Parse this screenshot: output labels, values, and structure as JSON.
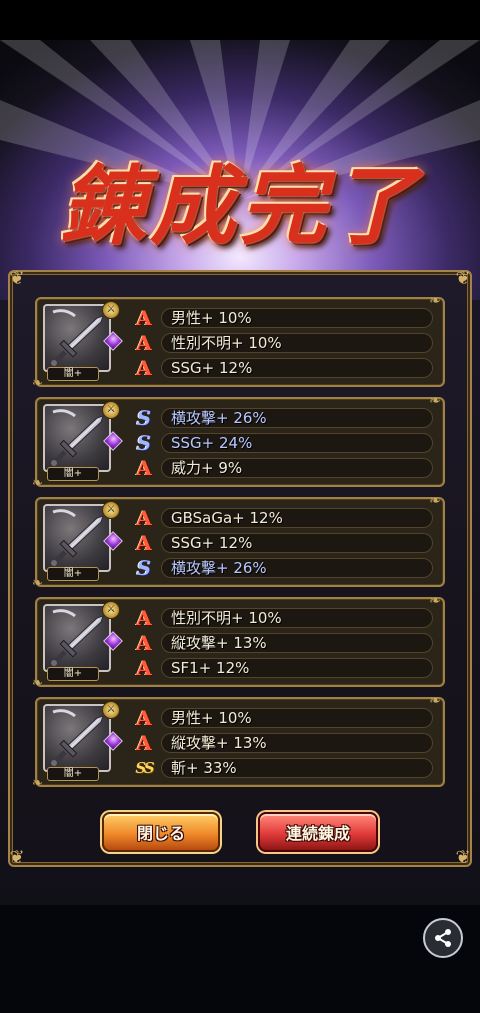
{
  "title": "錬成完了",
  "cards": [
    {
      "thumb_label": "闇+",
      "rows": [
        {
          "rank": "A",
          "text": "男性+ 10%",
          "style": "normal"
        },
        {
          "rank": "A",
          "text": "性別不明+ 10%",
          "style": "normal"
        },
        {
          "rank": "A",
          "text": "SSG+ 12%",
          "style": "normal"
        }
      ]
    },
    {
      "thumb_label": "闇+",
      "rows": [
        {
          "rank": "S",
          "text": "横攻撃+ 26%",
          "style": "blue"
        },
        {
          "rank": "S",
          "text": "SSG+ 24%",
          "style": "blue"
        },
        {
          "rank": "A",
          "text": "威力+ 9%",
          "style": "normal"
        }
      ]
    },
    {
      "thumb_label": "闇+",
      "rows": [
        {
          "rank": "A",
          "text": "GBSaGa+ 12%",
          "style": "normal"
        },
        {
          "rank": "A",
          "text": "SSG+ 12%",
          "style": "normal"
        },
        {
          "rank": "S",
          "text": "横攻撃+ 26%",
          "style": "blue"
        }
      ]
    },
    {
      "thumb_label": "闇+",
      "rows": [
        {
          "rank": "A",
          "text": "性別不明+ 10%",
          "style": "normal"
        },
        {
          "rank": "A",
          "text": "縦攻撃+ 13%",
          "style": "normal"
        },
        {
          "rank": "A",
          "text": "SF1+ 12%",
          "style": "normal"
        }
      ]
    },
    {
      "thumb_label": "闇+",
      "rows": [
        {
          "rank": "A",
          "text": "男性+ 10%",
          "style": "normal"
        },
        {
          "rank": "A",
          "text": "縦攻撃+ 13%",
          "style": "normal"
        },
        {
          "rank": "SS",
          "text": "斬+ 33%",
          "style": "normal"
        }
      ]
    }
  ],
  "buttons": {
    "close_label": "閉じる",
    "continue_label": "連続錬成"
  },
  "icons": {
    "share": "share-icon",
    "rank_a": "rank-a-icon",
    "rank_s": "rank-s-icon",
    "rank_ss": "rank-ss-icon"
  },
  "colors": {
    "panel_border": "#a48248",
    "rank_a": "#ff5b3a",
    "rank_s": "#9fb6ff",
    "rank_ss": "#ffd35a",
    "close_button": "#f08a2a",
    "continue_button": "#e23b3b"
  }
}
